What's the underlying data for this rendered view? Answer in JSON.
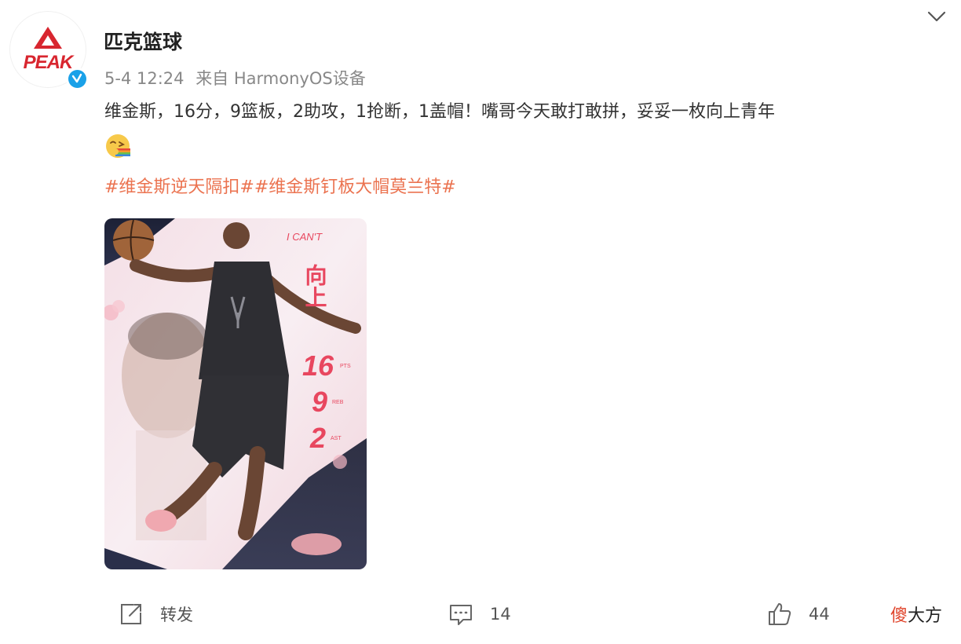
{
  "account": {
    "name": "匹克篮球",
    "logo_text": "PEAK",
    "brand_color": "#d8262f",
    "verified_color": "#1aa1e8"
  },
  "post": {
    "time": "5-4 12:24",
    "source": "来自 HarmonyOS设备",
    "text": "维金斯，16分，9篮板，2助攻，1抢断，1盖帽！嘴哥今天敢打敢拼，妥妥一枚向上青年",
    "hashtags": [
      "#维金斯逆天隔扣#",
      "#维金斯钉板大帽莫兰特#"
    ],
    "hashtag_color": "#eb7350"
  },
  "poster": {
    "slogan_en": "I CAN'T",
    "slogan_cn": "向上",
    "stats": [
      {
        "value": "16",
        "unit": "PTS"
      },
      {
        "value": "9",
        "unit": "REB"
      },
      {
        "value": "2",
        "unit": "AST"
      }
    ],
    "accent_color": "#e8475f"
  },
  "actions": {
    "repost_label": "转发",
    "comment_count": "14",
    "like_count": "44"
  },
  "watermark": {
    "highlight": "傻",
    "rest": "大方"
  }
}
